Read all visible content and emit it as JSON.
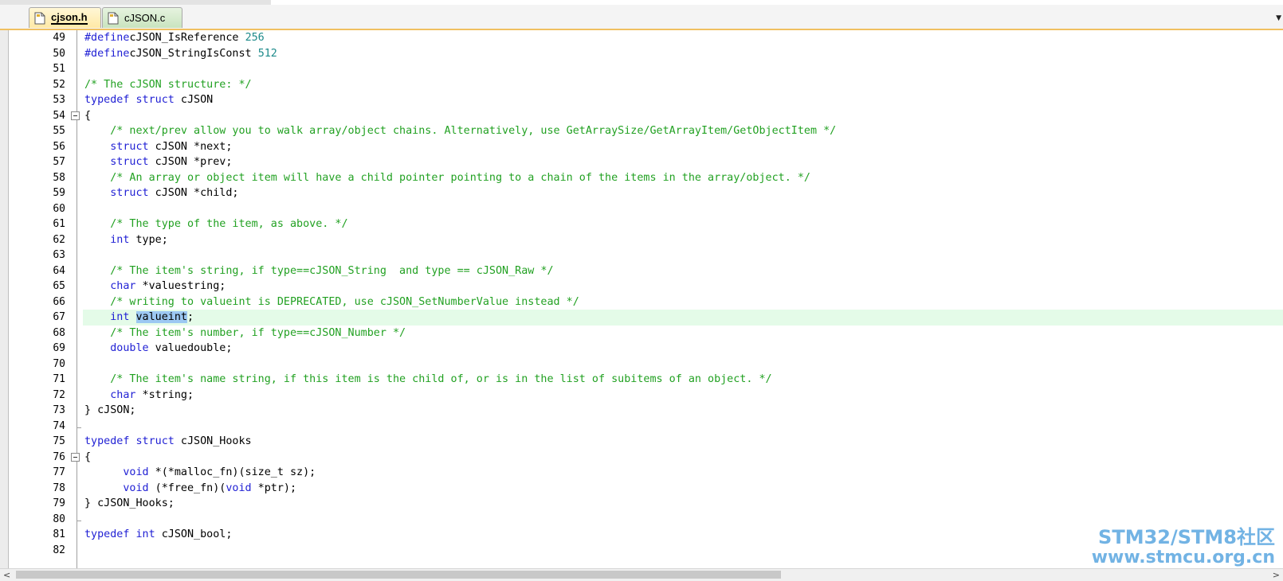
{
  "tabs": [
    {
      "label": "cjson.h",
      "active": true
    },
    {
      "label": "cJSON.c",
      "active": false
    }
  ],
  "highlight_line": 67,
  "selected_word": "valueint",
  "code_lines": [
    {
      "n": "49",
      "segs": [
        [
          "pre",
          "#define"
        ],
        [
          "",
          "cJSON_IsReference "
        ],
        [
          "num",
          "256"
        ]
      ]
    },
    {
      "n": "50",
      "segs": [
        [
          "pre",
          "#define"
        ],
        [
          "",
          "cJSON_StringIsConst "
        ],
        [
          "num",
          "512"
        ]
      ]
    },
    {
      "n": "51",
      "segs": []
    },
    {
      "n": "52",
      "segs": [
        [
          "cm",
          "/* The cJSON structure: */"
        ]
      ]
    },
    {
      "n": "53",
      "segs": [
        [
          "kw",
          "typedef"
        ],
        [
          "",
          " "
        ],
        [
          "kw",
          "struct"
        ],
        [
          "",
          " cJSON"
        ]
      ]
    },
    {
      "n": "54",
      "fold": "open",
      "segs": [
        [
          "",
          "{"
        ]
      ]
    },
    {
      "n": "55",
      "segs": [
        [
          "",
          "    "
        ],
        [
          "cm",
          "/* next/prev allow you to walk array/object chains. Alternatively, use GetArraySize/GetArrayItem/GetObjectItem */"
        ]
      ]
    },
    {
      "n": "56",
      "segs": [
        [
          "",
          "    "
        ],
        [
          "kw",
          "struct"
        ],
        [
          "",
          " cJSON *next;"
        ]
      ]
    },
    {
      "n": "57",
      "segs": [
        [
          "",
          "    "
        ],
        [
          "kw",
          "struct"
        ],
        [
          "",
          " cJSON *prev;"
        ]
      ]
    },
    {
      "n": "58",
      "segs": [
        [
          "",
          "    "
        ],
        [
          "cm",
          "/* An array or object item will have a child pointer pointing to a chain of the items in the array/object. */"
        ]
      ]
    },
    {
      "n": "59",
      "segs": [
        [
          "",
          "    "
        ],
        [
          "kw",
          "struct"
        ],
        [
          "",
          " cJSON *child;"
        ]
      ]
    },
    {
      "n": "60",
      "segs": []
    },
    {
      "n": "61",
      "segs": [
        [
          "",
          "    "
        ],
        [
          "cm",
          "/* The type of the item, as above. */"
        ]
      ]
    },
    {
      "n": "62",
      "segs": [
        [
          "",
          "    "
        ],
        [
          "kw",
          "int"
        ],
        [
          "",
          " type;"
        ]
      ]
    },
    {
      "n": "63",
      "segs": []
    },
    {
      "n": "64",
      "segs": [
        [
          "",
          "    "
        ],
        [
          "cm",
          "/* The item's string, if type==cJSON_String  and type == cJSON_Raw */"
        ]
      ]
    },
    {
      "n": "65",
      "segs": [
        [
          "",
          "    "
        ],
        [
          "kw",
          "char"
        ],
        [
          "",
          " *valuestring;"
        ]
      ]
    },
    {
      "n": "66",
      "segs": [
        [
          "",
          "    "
        ],
        [
          "cm",
          "/* writing to valueint is DEPRECATED, use cJSON_SetNumberValue instead */"
        ]
      ]
    },
    {
      "n": "67",
      "segs": [
        [
          "",
          "    "
        ],
        [
          "kw",
          "int"
        ],
        [
          "",
          " "
        ],
        [
          "sel",
          "valueint"
        ],
        [
          "",
          ";"
        ]
      ]
    },
    {
      "n": "68",
      "segs": [
        [
          "",
          "    "
        ],
        [
          "cm",
          "/* The item's number, if type==cJSON_Number */"
        ]
      ]
    },
    {
      "n": "69",
      "segs": [
        [
          "",
          "    "
        ],
        [
          "kw",
          "double"
        ],
        [
          "",
          " valuedouble;"
        ]
      ]
    },
    {
      "n": "70",
      "segs": []
    },
    {
      "n": "71",
      "segs": [
        [
          "",
          "    "
        ],
        [
          "cm",
          "/* The item's name string, if this item is the child of, or is in the list of subitems of an object. */"
        ]
      ]
    },
    {
      "n": "72",
      "segs": [
        [
          "",
          "    "
        ],
        [
          "kw",
          "char"
        ],
        [
          "",
          " *string;"
        ]
      ]
    },
    {
      "n": "73",
      "segs": [
        [
          "",
          "} cJSON;"
        ]
      ]
    },
    {
      "n": "74",
      "foldend": true,
      "segs": []
    },
    {
      "n": "75",
      "segs": [
        [
          "kw",
          "typedef"
        ],
        [
          "",
          " "
        ],
        [
          "kw",
          "struct"
        ],
        [
          "",
          " cJSON_Hooks"
        ]
      ]
    },
    {
      "n": "76",
      "fold": "open",
      "segs": [
        [
          "",
          "{"
        ]
      ]
    },
    {
      "n": "77",
      "segs": [
        [
          "",
          "      "
        ],
        [
          "kw",
          "void"
        ],
        [
          "",
          " *(*malloc_fn)(size_t sz);"
        ]
      ]
    },
    {
      "n": "78",
      "segs": [
        [
          "",
          "      "
        ],
        [
          "kw",
          "void"
        ],
        [
          "",
          " (*free_fn)("
        ],
        [
          "kw",
          "void"
        ],
        [
          "",
          " *ptr);"
        ]
      ]
    },
    {
      "n": "79",
      "segs": [
        [
          "",
          "} cJSON_Hooks;"
        ]
      ]
    },
    {
      "n": "80",
      "foldend": true,
      "segs": []
    },
    {
      "n": "81",
      "segs": [
        [
          "kw",
          "typedef"
        ],
        [
          "",
          " "
        ],
        [
          "kw",
          "int"
        ],
        [
          "",
          " cJSON_bool;"
        ]
      ]
    },
    {
      "n": "82",
      "segs": []
    }
  ],
  "watermark": {
    "line1": "STM32/STM8社区",
    "line2": "www.stmcu.org.cn"
  },
  "colors": {
    "keyword": "#1f1fd4",
    "number": "#1d8a8a",
    "comment": "#22a122",
    "selection": "#9cc8f2",
    "current_line": "#e4fbe8"
  },
  "icons": {
    "tab_file": "file-icon",
    "tab_menu": "chevron-down-icon",
    "scroll_left": "arrow-left-icon",
    "scroll_right": "arrow-right-icon",
    "fold": "fold-collapse-icon"
  }
}
